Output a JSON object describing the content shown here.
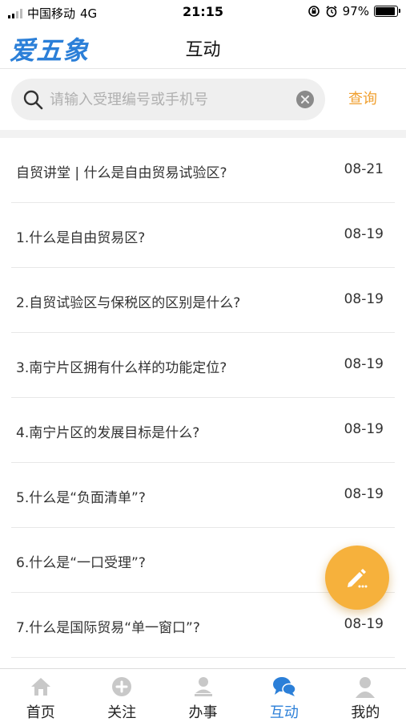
{
  "status_bar": {
    "carrier": "中国移动",
    "network": "4G",
    "time": "21:15",
    "battery": "97%"
  },
  "header": {
    "logo": "爱五象",
    "title": "互动"
  },
  "search": {
    "placeholder": "请输入受理编号或手机号",
    "value": "",
    "query_label": "查询"
  },
  "list": [
    {
      "title": "自贸讲堂 | 什么是自由贸易试验区?",
      "date": "08-21"
    },
    {
      "title": "1.什么是自由贸易区?",
      "date": "08-19"
    },
    {
      "title": "2.自贸试验区与保税区的区别是什么?",
      "date": "08-19"
    },
    {
      "title": "3.南宁片区拥有什么样的功能定位?",
      "date": "08-19"
    },
    {
      "title": "4.南宁片区的发展目标是什么?",
      "date": "08-19"
    },
    {
      "title": "5.什么是“负面清单”?",
      "date": "08-19"
    },
    {
      "title": "6.什么是“一口受理”?",
      "date": ""
    },
    {
      "title": "7.什么是国际贸易“单一窗口”?",
      "date": "08-19"
    }
  ],
  "tabbar": {
    "items": [
      {
        "label": "首页",
        "icon": "home-icon"
      },
      {
        "label": "关注",
        "icon": "plus-circle-icon"
      },
      {
        "label": "办事",
        "icon": "person-desk-icon"
      },
      {
        "label": "互动",
        "icon": "chat-bubbles-icon"
      },
      {
        "label": "我的",
        "icon": "user-icon"
      }
    ],
    "active_index": 3
  },
  "colors": {
    "brand_blue": "#2b7fd8",
    "accent_orange": "#f6b13c",
    "query_orange": "#f0a030",
    "inactive_gray": "#c8c8c8"
  }
}
